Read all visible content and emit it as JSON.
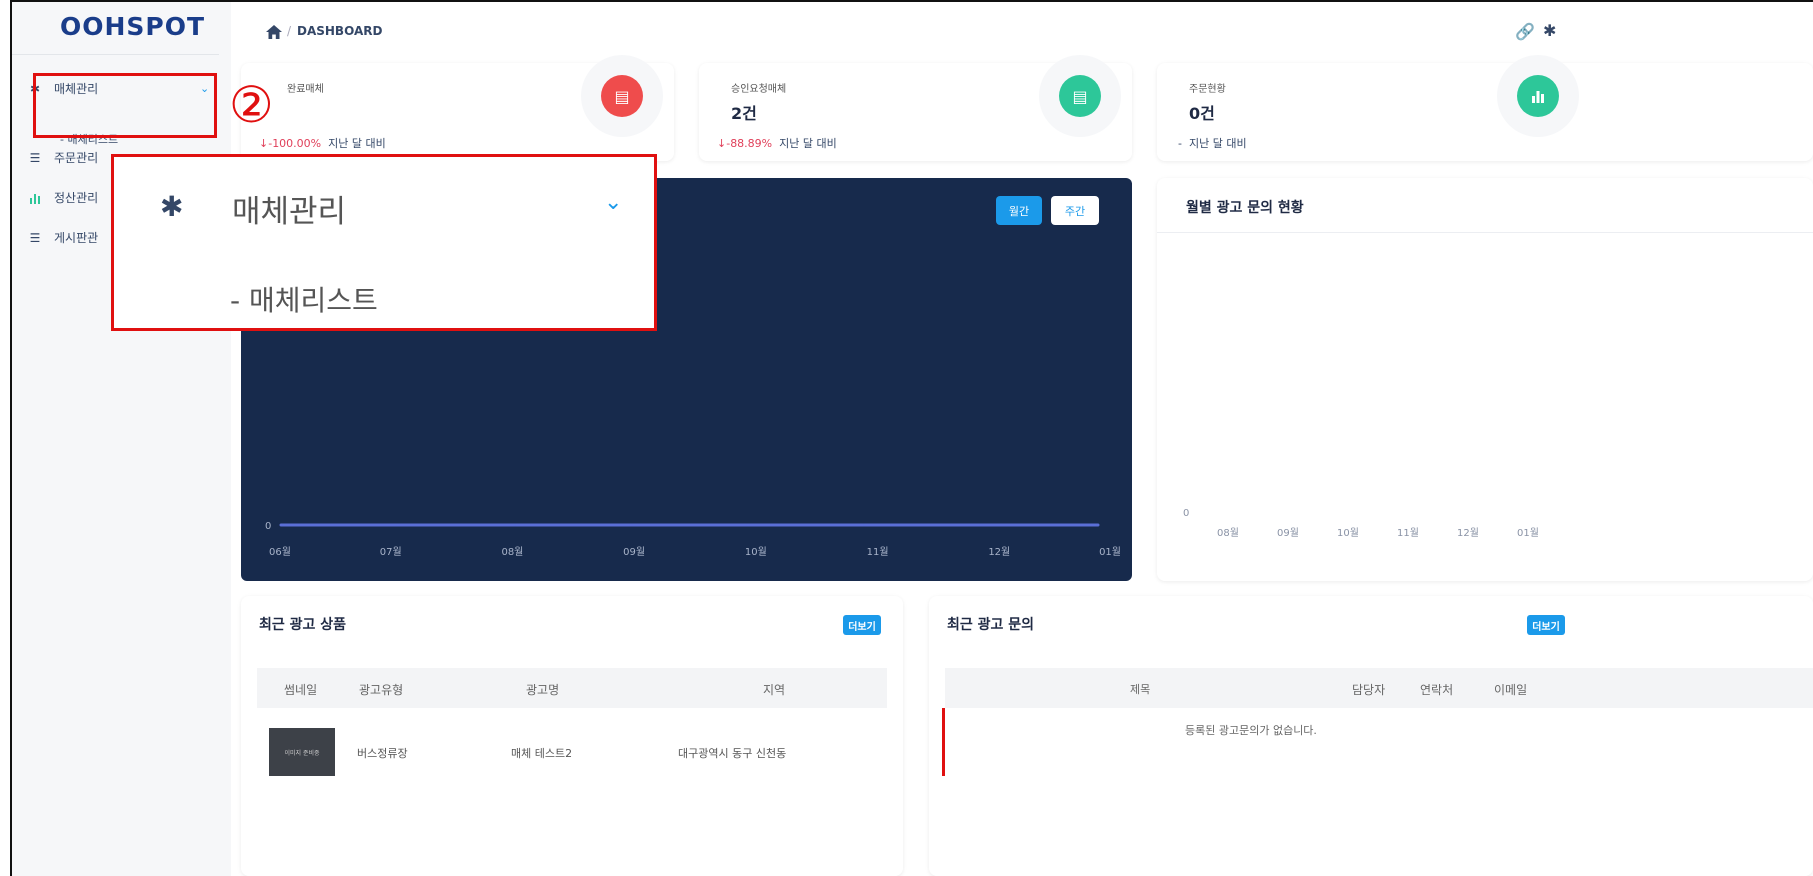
{
  "sidebar": {
    "logo": "OOHSPOT",
    "items": [
      {
        "label": "매체관리",
        "icon": "gear-icon"
      },
      {
        "label": "주문관리",
        "icon": "list-icon"
      },
      {
        "label": "정산관리",
        "icon": "bar-chart-icon"
      },
      {
        "label": "게시판관",
        "icon": "list-icon"
      }
    ],
    "sub_item": "- 매체리스트"
  },
  "annotation": {
    "step": "②"
  },
  "header": {
    "sep": "/",
    "breadcrumb": "DASHBOARD"
  },
  "stats": [
    {
      "label": "완료매체",
      "value": "",
      "delta": "-100.00%",
      "suffix": "지난 달 대비",
      "color": "#ef4c4c",
      "icon": "card-icon"
    },
    {
      "label": "승인요청매체",
      "value": "2건",
      "delta": "-88.89%",
      "suffix": "지난 달 대비",
      "color": "#2dc799",
      "icon": "card-icon"
    },
    {
      "label": "주문현황",
      "value": "0건",
      "delta": "-",
      "suffix": "지난 달 대비",
      "color": "#2dc799",
      "icon": "bar-chart-icon"
    }
  ],
  "zoom": {
    "title": "매체관리",
    "sub": "- 매체리스트"
  },
  "main_chart": {
    "buttons": {
      "month": "월간",
      "week": "주간"
    }
  },
  "right_chart": {
    "title": "월별 광고 문의 현황"
  },
  "chart_data": [
    {
      "type": "line",
      "x": [
        "06월",
        "07월",
        "08월",
        "09월",
        "10월",
        "11월",
        "12월",
        "01월"
      ],
      "series": [
        {
          "values": [
            0,
            0,
            0,
            0,
            0,
            0,
            0,
            0
          ]
        }
      ],
      "yticks": [
        "0"
      ],
      "title": "",
      "color": "#5b6fd6",
      "background": "#172a4c"
    },
    {
      "type": "bar",
      "categories": [
        "08월",
        "09월",
        "10월",
        "11월",
        "12월",
        "01월"
      ],
      "values": [
        0,
        0,
        0,
        0,
        0,
        0
      ],
      "yticks": [
        "0"
      ],
      "title": "월별 광고 문의 현황"
    }
  ],
  "recent_products": {
    "title": "최근 광고 상품",
    "more": "더보기",
    "columns": [
      "썸네일",
      "광고유형",
      "광고명",
      "지역"
    ],
    "rows": [
      {
        "thumb": "이미지 준비중",
        "type": "버스정류장",
        "name": "매체 테스트2",
        "region": "대구광역시 동구 신천동"
      }
    ]
  },
  "recent_inquiries": {
    "title": "최근 광고 문의",
    "more": "더보기",
    "columns": [
      "제목",
      "담당자",
      "연락처",
      "이메일"
    ],
    "empty": "등록된 광고문의가 없습니다."
  }
}
